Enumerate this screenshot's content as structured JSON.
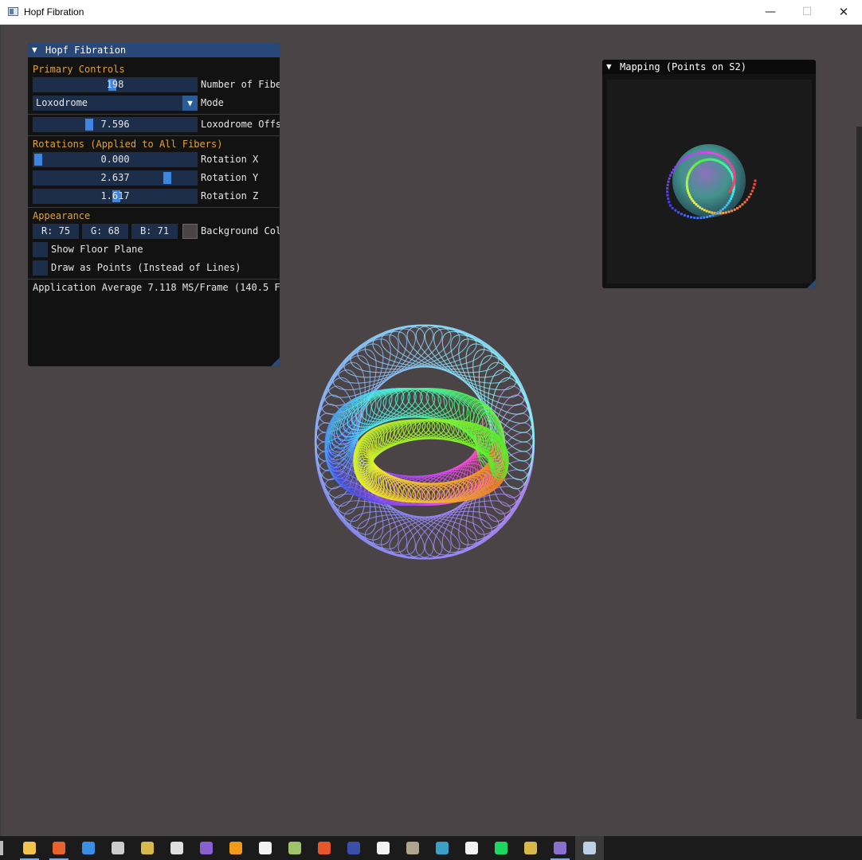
{
  "window": {
    "title": "Hopf Fibration",
    "minimize_glyph": "—",
    "maximize_glyph": "☐",
    "close_glyph": "✕"
  },
  "controls": {
    "title": "Hopf Fibration",
    "collapse_glyph": "▼",
    "primary_section": "Primary Controls",
    "fibers": {
      "value": "198",
      "label": "Number of Fibe",
      "fraction": 0.48
    },
    "mode": {
      "value": "Loxodrome",
      "label": "Mode",
      "arrow": "▼"
    },
    "offset": {
      "value": "7.596",
      "label": "Loxodrome Offs",
      "fraction": 0.33
    },
    "rotations_section": "Rotations (Applied to All Fibers)",
    "rot_x": {
      "value": "0.000",
      "label": "Rotation X",
      "fraction": 0.0
    },
    "rot_y": {
      "value": "2.637",
      "label": "Rotation Y",
      "fraction": 0.84
    },
    "rot_z": {
      "value": "1.617",
      "label": "Rotation Z",
      "fraction": 0.51
    },
    "appearance_section": "Appearance",
    "bg_r": "R: 75",
    "bg_g": "G: 68",
    "bg_b": "B: 71",
    "bg_label": "Background Col",
    "floor_label": "Show Floor Plane",
    "points_label": "Draw as Points (Instead of Lines)",
    "stats": "Application Average 7.118 MS/Frame (140.5 FP"
  },
  "mapping": {
    "title": "Mapping (Points on S2)",
    "collapse_glyph": "▼"
  },
  "colors": {
    "viewport_bg": "#4b4447",
    "panel_bg": "#0f0f0f",
    "title_active": "#29487a",
    "frame_bg": "#1c2e4a",
    "slider_grab": "#3d85e0",
    "section_text": "#e0a23a"
  },
  "taskbar": {
    "items": [
      {
        "name": "file-explorer-icon",
        "color": "#f0c54a"
      },
      {
        "name": "firefox-icon",
        "color": "#e8632b"
      },
      {
        "name": "messenger-icon",
        "color": "#3a8ee6"
      },
      {
        "name": "command-prompt-icon",
        "color": "#cccccc"
      },
      {
        "name": "git-icon",
        "color": "#d9b84a"
      },
      {
        "name": "unity-icon",
        "color": "#e0e0e0"
      },
      {
        "name": "visual-studio-icon",
        "color": "#8a5fd0"
      },
      {
        "name": "sublime-text-icon",
        "color": "#f29a1a"
      },
      {
        "name": "source-control-icon",
        "color": "#f2f2f2"
      },
      {
        "name": "tool-icon",
        "color": "#9fc36a"
      },
      {
        "name": "office-icon",
        "color": "#e6562a"
      },
      {
        "name": "paint-icon",
        "color": "#3a4fa8"
      },
      {
        "name": "cinema-icon",
        "color": "#f2f2f2"
      },
      {
        "name": "gimp-icon",
        "color": "#b0a48c"
      },
      {
        "name": "krita-icon",
        "color": "#3aa0c8"
      },
      {
        "name": "blender-icon",
        "color": "#f2f2f2"
      },
      {
        "name": "spotify-icon",
        "color": "#1ed760"
      },
      {
        "name": "git-bash-icon",
        "color": "#d9b84a"
      },
      {
        "name": "terminal-icon",
        "color": "#8a6fd0"
      },
      {
        "name": "hopf-app-icon",
        "color": "#bcd0e6"
      }
    ]
  }
}
